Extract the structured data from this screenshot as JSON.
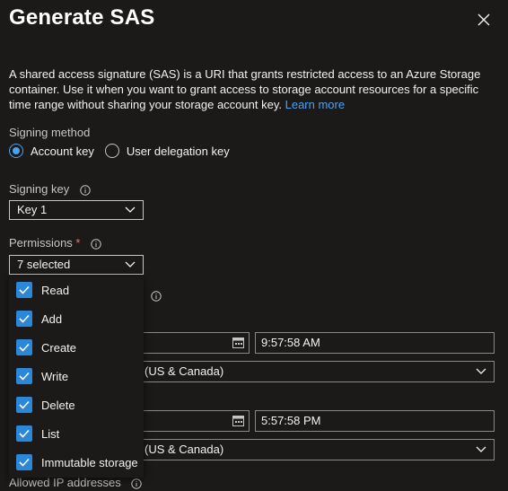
{
  "dialog": {
    "title": "Generate SAS",
    "description": "A shared access signature (SAS) is a URI that grants restricted access to an Azure Storage container. Use it when you want to grant access to storage account resources for a specific time range without sharing your storage account key.",
    "learn_more": "Learn more"
  },
  "signing_method": {
    "label": "Signing method",
    "options": [
      "Account key",
      "User delegation key"
    ],
    "selected": "Account key"
  },
  "signing_key": {
    "label": "Signing key",
    "value": "Key 1"
  },
  "permissions": {
    "label": "Permissions",
    "required_mark": "*",
    "value": "7 selected",
    "options": [
      "Read",
      "Add",
      "Create",
      "Write",
      "Delete",
      "List",
      "Immutable storage"
    ]
  },
  "start": {
    "time": "9:57:58 AM",
    "timezone_partial": "(US & Canada)"
  },
  "expiry": {
    "time": "5:57:58 PM",
    "timezone_partial": "(US & Canada)"
  },
  "allowed_ip": {
    "label": "Allowed IP addresses"
  },
  "colors": {
    "background": "#1b1a19",
    "accent": "#2b88d8",
    "link": "#4aa3f0"
  }
}
